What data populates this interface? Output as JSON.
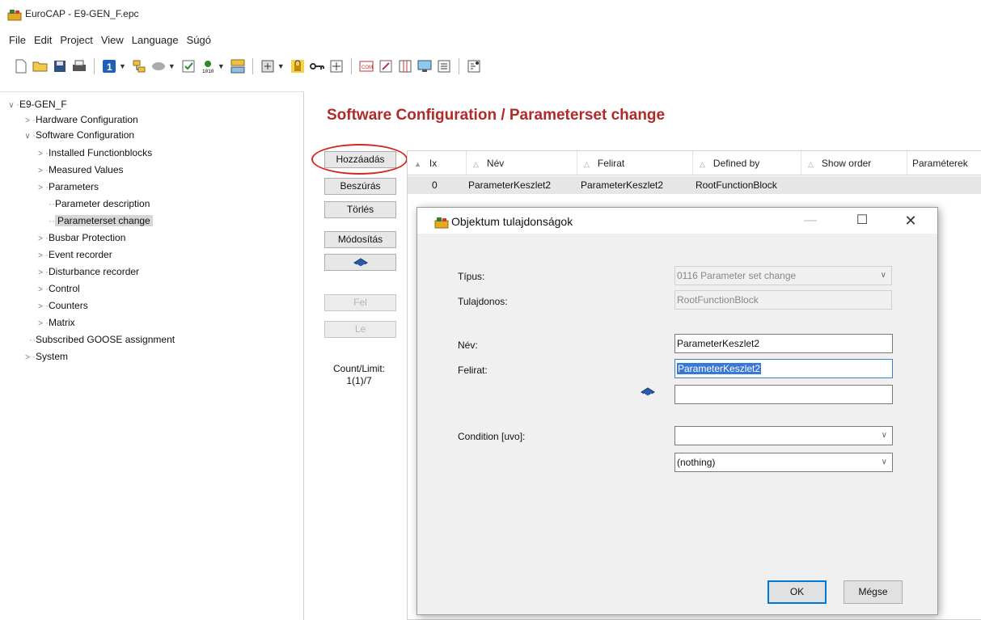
{
  "window": {
    "title": "EuroCAP - E9-GEN_F.epc"
  },
  "menu": [
    "File",
    "Edit",
    "Project",
    "View",
    "Language",
    "Súgó"
  ],
  "tree": {
    "root": "E9-GEN_F",
    "hardware": "Hardware Configuration",
    "software": "Software Configuration",
    "installed": "Installed Functionblocks",
    "measured": "Measured Values",
    "parameters": "Parameters",
    "param_desc": "Parameter description",
    "paramset_change": "Parameterset change",
    "busbar": "Busbar Protection",
    "event": "Event recorder",
    "disturbance": "Disturbance recorder",
    "control": "Control",
    "counters": "Counters",
    "matrix": "Matrix",
    "goose": "Subscribed GOOSE assignment",
    "system": "System"
  },
  "page": {
    "title": "Software Configuration / Parameterset change"
  },
  "buttons": {
    "add": "Hozzáadás",
    "insert": "Beszúrás",
    "delete": "Törlés",
    "modify": "Módosítás",
    "up": "Fel",
    "down": "Le"
  },
  "count": {
    "label": "Count/Limit:",
    "value": "1(1)/7"
  },
  "grid": {
    "columns": [
      "Ix",
      "Név",
      "Felirat",
      "Defined by",
      "Show order",
      "Paraméterek"
    ],
    "rows": [
      {
        "ix": "0",
        "nev": "ParameterKeszlet2",
        "felirat": "ParameterKeszlet2",
        "defined_by": "RootFunctionBlock"
      }
    ]
  },
  "dialog": {
    "title": "Objektum tulajdonságok",
    "tipus_label": "Típus:",
    "tipus_value": "0116 Parameter set change",
    "tulajdonos_label": "Tulajdonos:",
    "tulajdonos_value": "RootFunctionBlock",
    "nev_label": "Név:",
    "nev_value": "ParameterKeszlet2",
    "felirat_label": "Felirat:",
    "felirat_value": "ParameterKeszlet2",
    "extra_value": "",
    "condition_label": "Condition [uvo]:",
    "condition_value": "",
    "nothing_value": "(nothing)",
    "ok": "OK",
    "cancel": "Mégse"
  },
  "colors": {
    "title_red": "#b02a2a",
    "highlight_ring": "#d6271f",
    "selection_blue": "#3a78d7"
  }
}
